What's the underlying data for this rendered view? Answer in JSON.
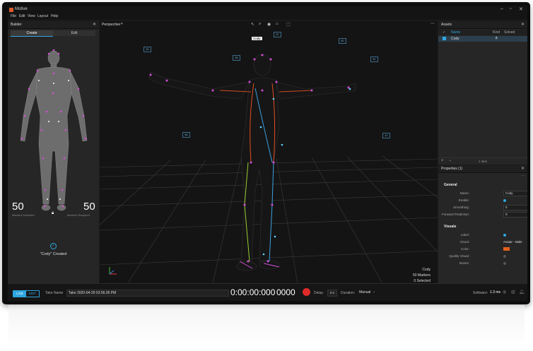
{
  "app": {
    "title": "Motive"
  },
  "menu": [
    "File",
    "Edit",
    "View",
    "Layout",
    "Help"
  ],
  "builder": {
    "title": "Builder",
    "tabs": [
      "Create",
      "Edit"
    ],
    "markers_detected": "50",
    "markers_detected_label": "Markers Detected",
    "markers_required": "50",
    "markers_required_label": "Markers Required",
    "status": "\"Cody\" Created"
  },
  "viewport": {
    "title": "Perspective",
    "skeleton_name": "Cody",
    "marker_labels": [
      "53",
      "58",
      "57",
      "60",
      "51",
      "5A",
      "42"
    ],
    "info": [
      "Cody",
      "50 Markers",
      "0 Selected"
    ]
  },
  "assets": {
    "title": "Assets",
    "columns": [
      "Name",
      "Kind",
      "Solved"
    ],
    "rows": [
      {
        "name": "Cody"
      }
    ],
    "count": "1 item"
  },
  "properties": {
    "title": "Properties (1)",
    "general": {
      "heading": "General",
      "name_label": "Name:",
      "name_value": "Cody",
      "enable_label": "Enable:",
      "smoothing_label": "Smoothing:",
      "smoothing_value": "0",
      "forward_label": "Forward Prediction:",
      "forward_value": "0"
    },
    "visuals": {
      "heading": "Visuals",
      "label_label": "Label:",
      "visual_label": "Visual:",
      "visual_value": "Avatar - Male",
      "color_label": "Color:",
      "quality_label": "Quality Visual:",
      "bones_label": "Bones:"
    }
  },
  "bottom": {
    "live": "LIVE",
    "edit": "EDIT",
    "take_label": "Take Name",
    "take_value": "Take 2020-04-29 03.56.05 PM",
    "timecode": "0:00:00:000",
    "frame": "0000",
    "delay_label": "Delay:",
    "delay_value": "0 s",
    "duration_label": "Duration:",
    "duration_value": "Manual",
    "software_label": "Software:",
    "software_value": "1.3 ms"
  },
  "colors": {
    "accent": "#2ea6e0",
    "record": "#e02a2a",
    "avatar_color": "#e0601c"
  }
}
